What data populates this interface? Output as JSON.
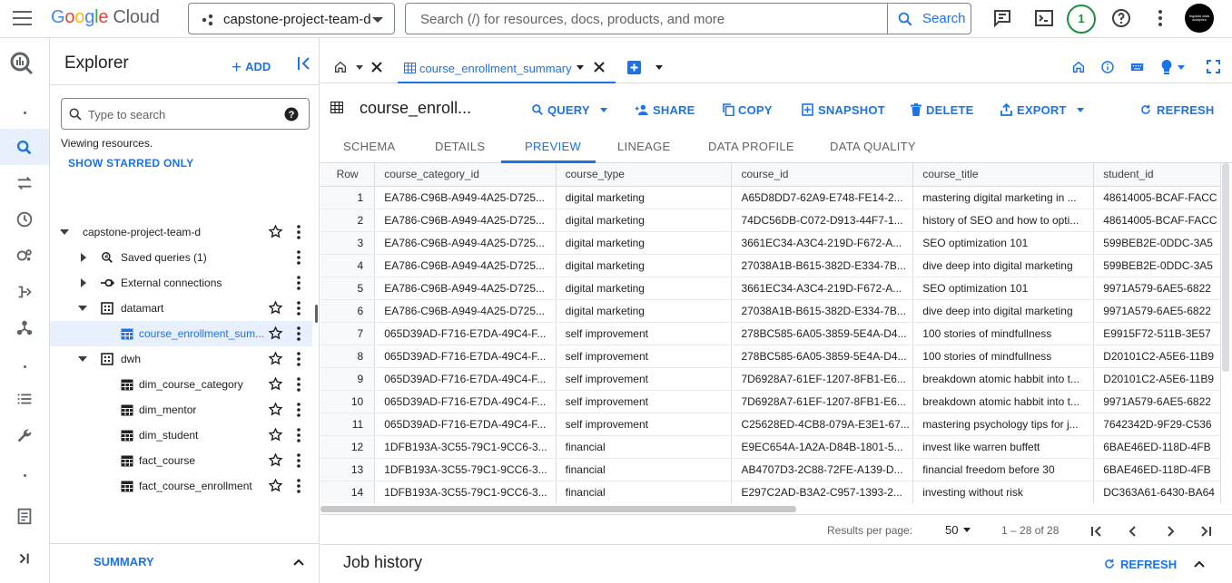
{
  "header": {
    "logo_google": "Google",
    "logo_cloud": "Cloud",
    "project": "capstone-project-team-d",
    "search_placeholder": "Search (/) for resources, docs, products, and more",
    "search_button": "Search",
    "notification_count": "1",
    "avatar_text": "bigdata data analytics"
  },
  "explorer": {
    "title": "Explorer",
    "add_label": "ADD",
    "search_placeholder": "Type to search",
    "viewing": "Viewing resources.",
    "show_starred": "SHOW STARRED ONLY",
    "summary": "SUMMARY",
    "tree": [
      {
        "label": "capstone-project-team-d",
        "indent": 0,
        "icon": "caret-down"
      },
      {
        "label": "Saved queries (1)",
        "indent": 1,
        "icon": "saved-queries"
      },
      {
        "label": "External connections",
        "indent": 1,
        "icon": "external-connections"
      },
      {
        "label": "datamart",
        "indent": 1,
        "icon": "dataset"
      },
      {
        "label": "course_enrollment_sum...",
        "indent": 2,
        "icon": "table",
        "selected": true
      },
      {
        "label": "dwh",
        "indent": 1,
        "icon": "dataset"
      },
      {
        "label": "dim_course_category",
        "indent": 2,
        "icon": "table"
      },
      {
        "label": "dim_mentor",
        "indent": 2,
        "icon": "table"
      },
      {
        "label": "dim_student",
        "indent": 2,
        "icon": "table"
      },
      {
        "label": "fact_course",
        "indent": 2,
        "icon": "table"
      },
      {
        "label": "fact_course_enrollment",
        "indent": 2,
        "icon": "table"
      }
    ]
  },
  "main": {
    "tab_label": "course_enrollment_summary",
    "title": "course_enroll...",
    "actions": {
      "query": "QUERY",
      "share": "SHARE",
      "copy": "COPY",
      "snapshot": "SNAPSHOT",
      "delete": "DELETE",
      "export": "EXPORT",
      "refresh": "REFRESH"
    },
    "subtabs": [
      "SCHEMA",
      "DETAILS",
      "PREVIEW",
      "LINEAGE",
      "DATA PROFILE",
      "DATA QUALITY"
    ],
    "table": {
      "columns": [
        "Row",
        "course_category_id",
        "course_type",
        "course_id",
        "course_title",
        "student_id"
      ],
      "rows": [
        [
          "1",
          "EA786-C96B-A949-4A25-D725...",
          "digital marketing",
          "A65D8DD7-62A9-E748-FE14-2...",
          "mastering digital marketing in ...",
          "48614005-BCAF-FACC"
        ],
        [
          "2",
          "EA786-C96B-A949-4A25-D725...",
          "digital marketing",
          "74DC56DB-C072-D913-44F7-1...",
          "history of SEO and how to opti...",
          "48614005-BCAF-FACC"
        ],
        [
          "3",
          "EA786-C96B-A949-4A25-D725...",
          "digital marketing",
          "3661EC34-A3C4-219D-F672-A...",
          "SEO optimization 101",
          "599BEB2E-0DDC-3A5"
        ],
        [
          "4",
          "EA786-C96B-A949-4A25-D725...",
          "digital marketing",
          "27038A1B-B615-382D-E334-7B...",
          "dive deep into digital marketing",
          "599BEB2E-0DDC-3A5"
        ],
        [
          "5",
          "EA786-C96B-A949-4A25-D725...",
          "digital marketing",
          "3661EC34-A3C4-219D-F672-A...",
          "SEO optimization 101",
          "9971A579-6AE5-6822"
        ],
        [
          "6",
          "EA786-C96B-A949-4A25-D725...",
          "digital marketing",
          "27038A1B-B615-382D-E334-7B...",
          "dive deep into digital marketing",
          "9971A579-6AE5-6822"
        ],
        [
          "7",
          "065D39AD-F716-E7DA-49C4-F...",
          "self improvement",
          "278BC585-6A05-3859-5E4A-D4...",
          "100 stories of mindfullness",
          "E9915F72-511B-3E57"
        ],
        [
          "8",
          "065D39AD-F716-E7DA-49C4-F...",
          "self improvement",
          "278BC585-6A05-3859-5E4A-D4...",
          "100 stories of mindfullness",
          "D20101C2-A5E6-11B9"
        ],
        [
          "9",
          "065D39AD-F716-E7DA-49C4-F...",
          "self improvement",
          "7D6928A7-61EF-1207-8FB1-E6...",
          "breakdown atomic habbit into t...",
          "D20101C2-A5E6-11B9"
        ],
        [
          "10",
          "065D39AD-F716-E7DA-49C4-F...",
          "self improvement",
          "7D6928A7-61EF-1207-8FB1-E6...",
          "breakdown atomic habbit into t...",
          "9971A579-6AE5-6822"
        ],
        [
          "11",
          "065D39AD-F716-E7DA-49C4-F...",
          "self improvement",
          "C25628ED-4CB8-079A-E3E1-67...",
          "mastering psychology tips for j...",
          "7642342D-9F29-C536"
        ],
        [
          "12",
          "1DFB193A-3C55-79C1-9CC6-3...",
          "financial",
          "E9EC654A-1A2A-D84B-1801-5...",
          "invest like warren buffett",
          "6BAE46ED-118D-4FB"
        ],
        [
          "13",
          "1DFB193A-3C55-79C1-9CC6-3...",
          "financial",
          "AB4707D3-2C88-72FE-A139-D...",
          "financial freedom before 30",
          "6BAE46ED-118D-4FB"
        ],
        [
          "14",
          "1DFB193A-3C55-79C1-9CC6-3...",
          "financial",
          "E297C2AD-B3A2-C957-1393-2...",
          "investing without risk",
          "DC363A61-6430-BA64"
        ]
      ]
    },
    "pagination": {
      "results_per_page_label": "Results per page:",
      "results_per_page": "50",
      "range": "1 – 28 of 28"
    },
    "job_history": {
      "title": "Job history",
      "refresh": "REFRESH"
    }
  },
  "colors": {
    "accent": "#1a73e8",
    "selected_bg": "#e8f0fe",
    "border": "#dadce0",
    "badge": "#1e8e3e"
  }
}
